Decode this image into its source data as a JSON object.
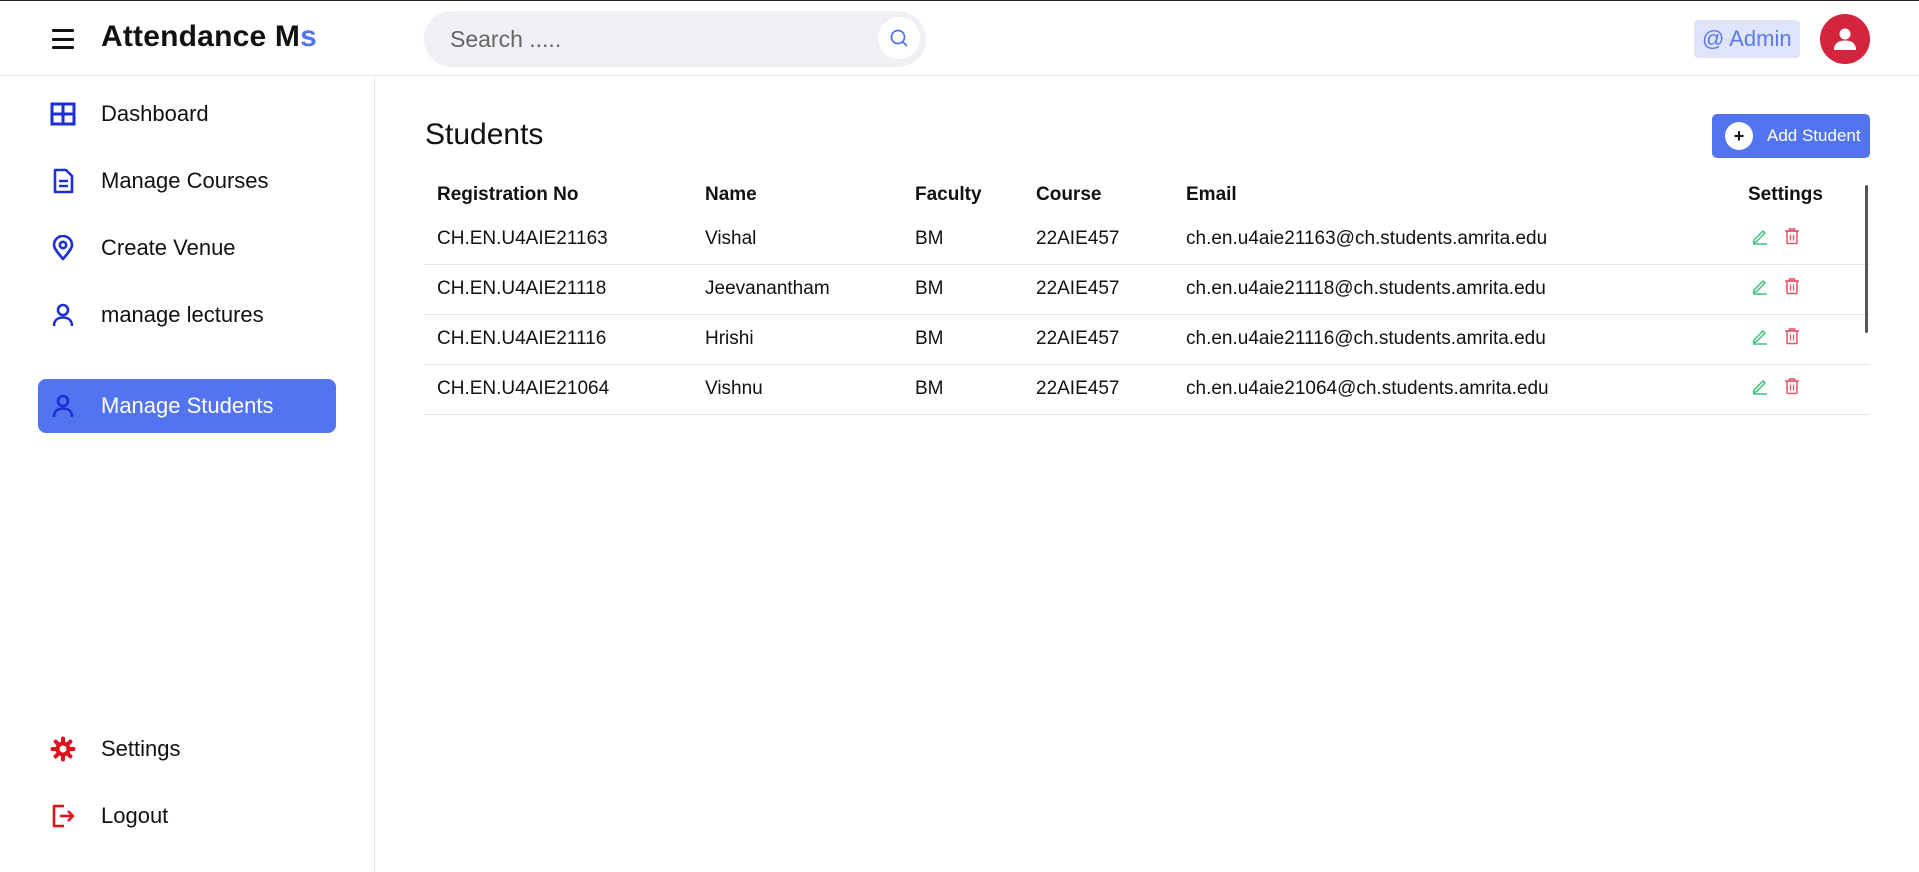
{
  "header": {
    "brand_main": "Attendance M",
    "brand_accent": "s",
    "search_placeholder": "Search .....",
    "admin_label": "@ Admin"
  },
  "sidebar": {
    "items": [
      {
        "label": "Dashboard",
        "icon": "grid-icon"
      },
      {
        "label": "Manage Courses",
        "icon": "document-icon"
      },
      {
        "label": "Create Venue",
        "icon": "location-pin-icon"
      },
      {
        "label": "manage lectures",
        "icon": "user-icon"
      },
      {
        "label": "Manage Students",
        "icon": "user-icon",
        "active": true
      }
    ],
    "bottom_items": [
      {
        "label": "Settings",
        "icon": "gear-icon"
      },
      {
        "label": "Logout",
        "icon": "logout-icon"
      }
    ]
  },
  "main": {
    "title": "Students",
    "add_button_label": "Add Student",
    "table": {
      "columns": [
        "Registration No",
        "Name",
        "Faculty",
        "Course",
        "Email",
        "Settings"
      ],
      "rows": [
        {
          "reg": "CH.EN.U4AIE21163",
          "name": "Vishal",
          "faculty": "BM",
          "course": "22AIE457",
          "email": "ch.en.u4aie21163@ch.students.amrita.edu"
        },
        {
          "reg": "CH.EN.U4AIE21118",
          "name": "Jeevanantham",
          "faculty": "BM",
          "course": "22AIE457",
          "email": "ch.en.u4aie21118@ch.students.amrita.edu"
        },
        {
          "reg": "CH.EN.U4AIE21116",
          "name": "Hrishi",
          "faculty": "BM",
          "course": "22AIE457",
          "email": "ch.en.u4aie21116@ch.students.amrita.edu"
        },
        {
          "reg": "CH.EN.U4AIE21064",
          "name": "Vishnu",
          "faculty": "BM",
          "course": "22AIE457",
          "email": "ch.en.u4aie21064@ch.students.amrita.edu"
        }
      ]
    }
  },
  "colors": {
    "accent": "#5274f0",
    "nav_icon": "#1a2fd6",
    "danger_icon": "#e0101e",
    "edit_icon": "#3fbf7f",
    "delete_icon": "#e0556a",
    "avatar": "#d5243d"
  }
}
